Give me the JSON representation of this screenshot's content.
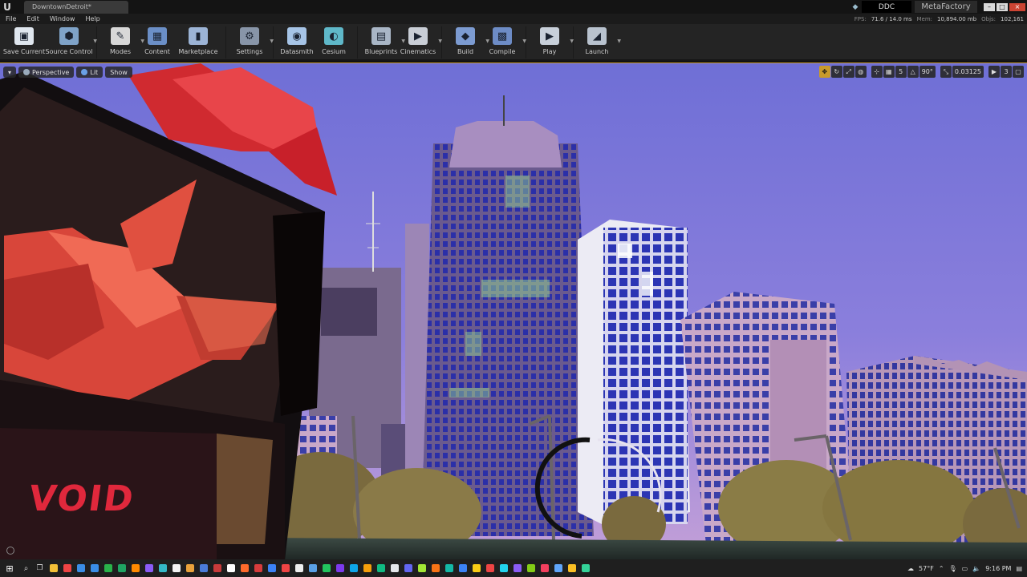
{
  "window": {
    "document_tab": "DowntownDetroit*",
    "ddc_label": "DDC",
    "project_name": "MetaFactory"
  },
  "menu": [
    "File",
    "Edit",
    "Window",
    "Help"
  ],
  "stats": {
    "fps_label": "FPS:",
    "fps_value": "71.6 / 14.0 ms",
    "mem_label": "Mem:",
    "mem_value": "10,894.00 mb",
    "objs_label": "Objs:",
    "objs_value": "102,161"
  },
  "toolbar": [
    {
      "label": "Save Current",
      "icon": "save-icon",
      "color": "#dfe6ee"
    },
    {
      "label": "Source Control",
      "icon": "source-control-icon",
      "color": "#7fa3c8",
      "caret": true
    },
    {
      "label": "Modes",
      "icon": "modes-icon",
      "color": "#d8d8d8",
      "caret": true
    },
    {
      "label": "Content",
      "icon": "content-icon",
      "color": "#6b8fc7"
    },
    {
      "label": "Marketplace",
      "icon": "marketplace-icon",
      "color": "#9cb4d6"
    },
    {
      "label": "Settings",
      "icon": "settings-icon",
      "color": "#8895a8",
      "caret": true
    },
    {
      "label": "Datasmith",
      "icon": "datasmith-icon",
      "color": "#a6c4e6"
    },
    {
      "label": "Cesium",
      "icon": "cesium-icon",
      "color": "#5fb8c9"
    },
    {
      "label": "Blueprints",
      "icon": "blueprints-icon",
      "color": "#a9b6c6",
      "caret": true
    },
    {
      "label": "Cinematics",
      "icon": "cinematics-icon",
      "color": "#c9ced6",
      "caret": true
    },
    {
      "label": "Build",
      "icon": "build-icon",
      "color": "#7c9bd1",
      "caret": true
    },
    {
      "label": "Compile",
      "icon": "compile-icon",
      "color": "#6d8cc6",
      "caret": true
    },
    {
      "label": "Play",
      "icon": "play-icon",
      "color": "#c8d0da",
      "caret": true
    },
    {
      "label": "Launch",
      "icon": "launch-icon",
      "color": "#b8c2ce",
      "caret": true
    }
  ],
  "viewport": {
    "perspective": "Perspective",
    "lit": "Lit",
    "show": "Show",
    "grid_snap": "5",
    "angle_snap": "90°",
    "scale_snap": "0.03125",
    "camera_speed": "3",
    "sign_text": "VOID"
  },
  "taskbar": {
    "apps": [
      "#f2c037",
      "#e44",
      "#3a8ee6",
      "#3a8ee6",
      "#29b34a",
      "#1fa463",
      "#ff8a00",
      "#8a5cf6",
      "#34b8c7",
      "#f2f2f2",
      "#e9a23b",
      "#4a7cd9",
      "#c83b3b",
      "#ffffff",
      "#ff6a2b",
      "#d73c3c",
      "#3b82f6",
      "#ef4444",
      "#eeeeee",
      "#5aa0e6",
      "#22c55e",
      "#7c3aed",
      "#0ea5e9",
      "#f59e0b",
      "#10b981",
      "#e5e7eb",
      "#6366f1",
      "#a3e635",
      "#f97316",
      "#14b8a6",
      "#3b82f6",
      "#facc15",
      "#ef4444",
      "#22d3ee",
      "#8b5cf6",
      "#84cc16",
      "#f43f5e",
      "#60a5fa",
      "#fbbf24",
      "#34d399"
    ],
    "temperature": "57°F",
    "time": "9:16 PM"
  }
}
